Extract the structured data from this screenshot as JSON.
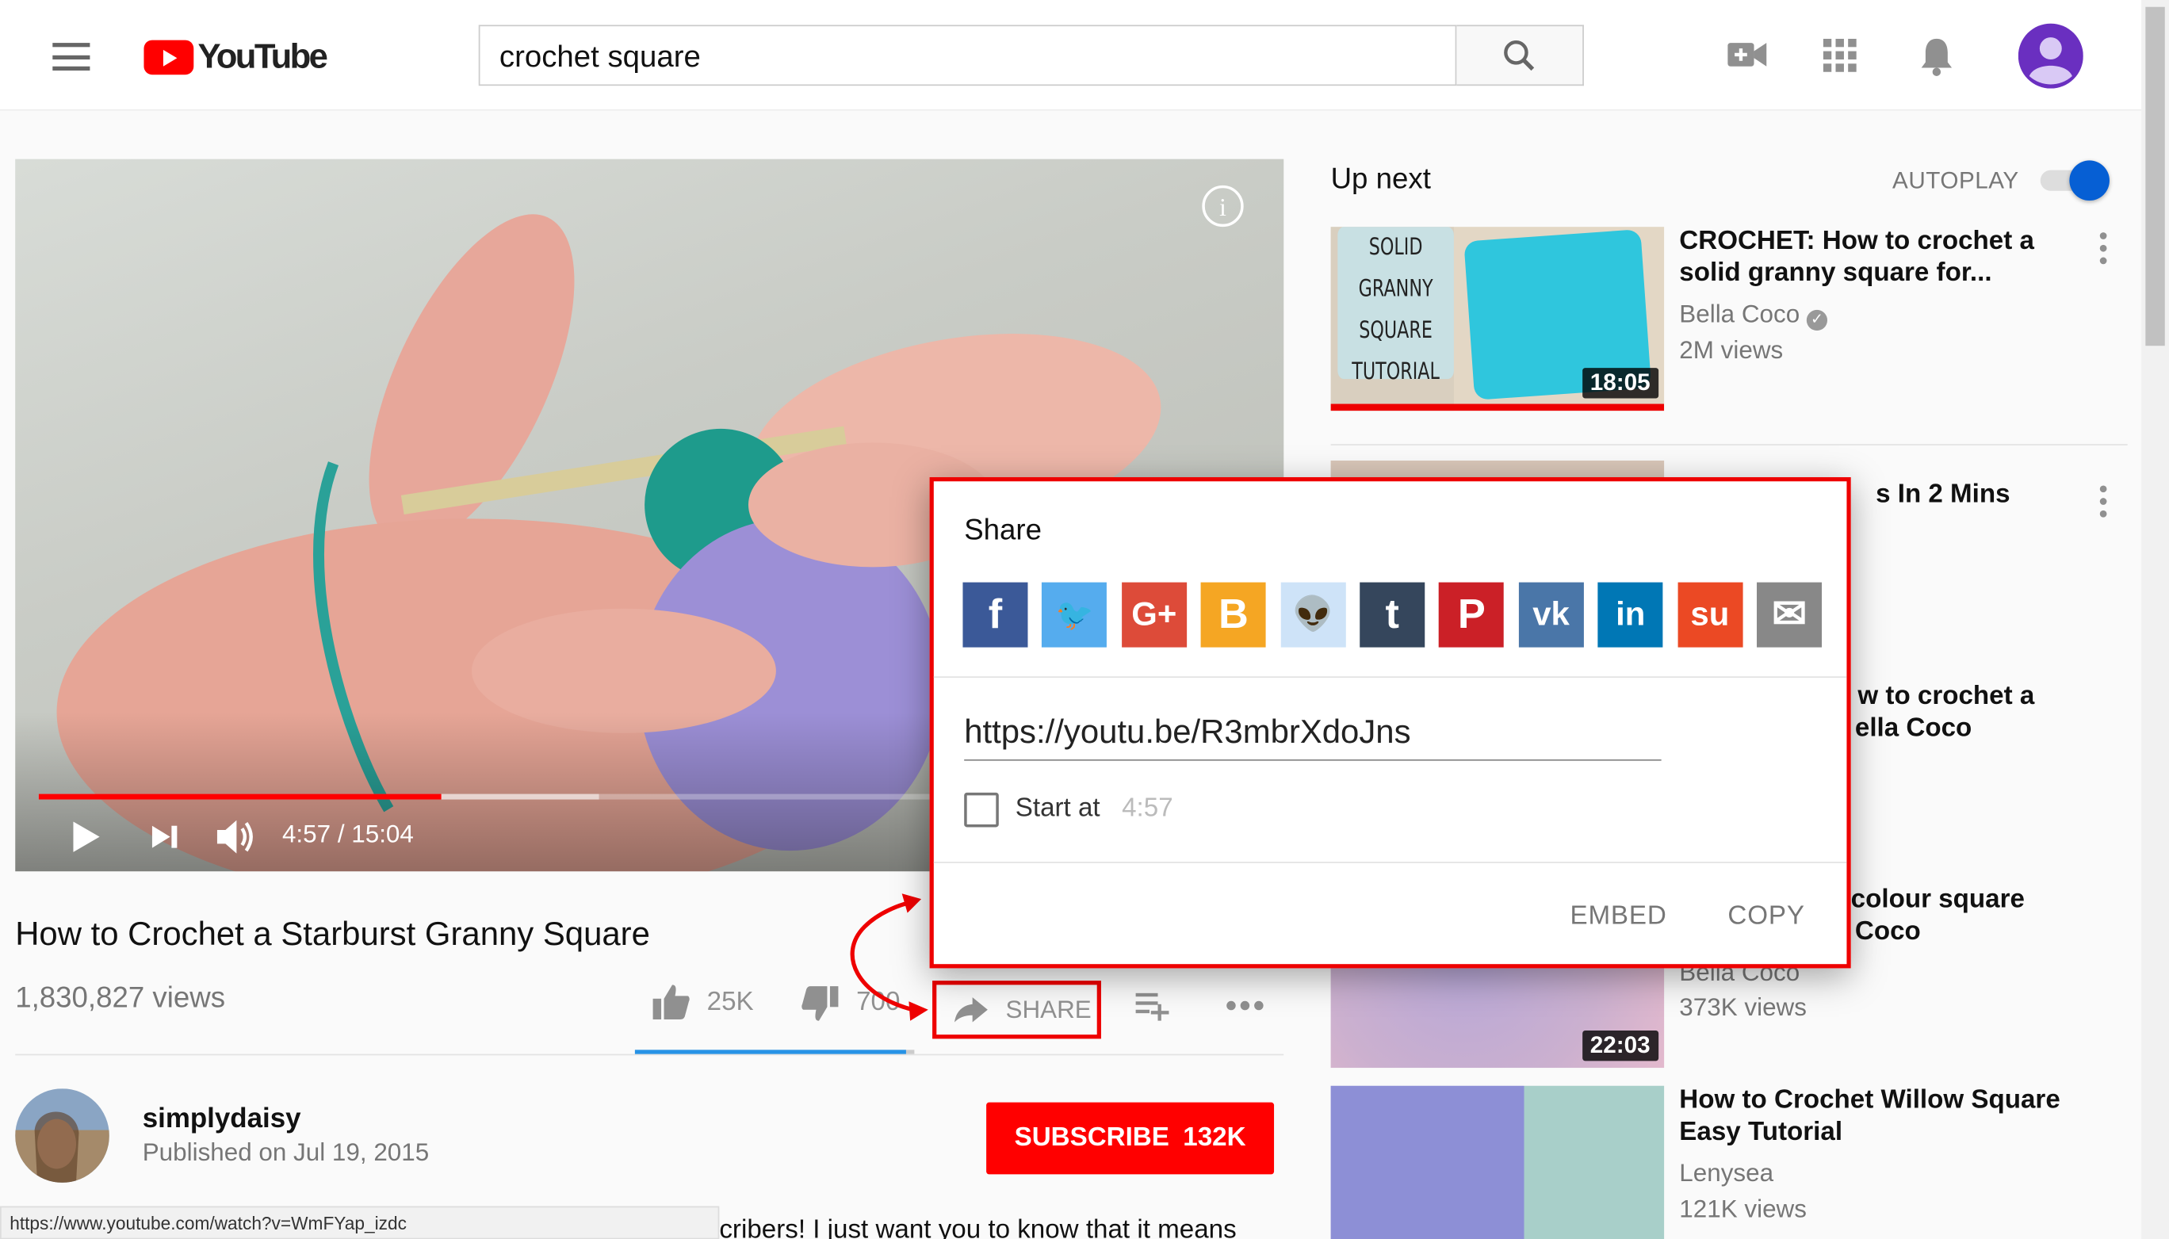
{
  "header": {
    "logo_text": "YouTube",
    "search_value": "crochet square",
    "icons": [
      "menu-icon",
      "search-icon",
      "video-camera-add-icon",
      "apps-grid-icon",
      "bell-icon",
      "account-avatar"
    ]
  },
  "player": {
    "time": "4:57 / 15:04",
    "progress_fraction": 0.329,
    "buffered_fraction": 0.459
  },
  "video": {
    "title": "How to Crochet a Starburst Granny Square",
    "views": "1,830,827 views",
    "likes": "25K",
    "dislikes": "700",
    "share_label": "SHARE",
    "like_ratio": 0.97
  },
  "channel": {
    "name": "simplydaisy",
    "published": "Published on Jul 19, 2015",
    "subscribe_label": "SUBSCRIBE",
    "subscriber_count": "132K"
  },
  "description_fragment": "cribers! I just want you to know that it means",
  "status_bar_url": "https://www.youtube.com/watch?v=WmFYap_izdc",
  "sidebar": {
    "up_next": "Up next",
    "autoplay_label": "AUTOPLAY",
    "autoplay_on": true,
    "items": [
      {
        "title": "CROCHET: How to crochet a solid granny square for...",
        "channel": "Bella Coco",
        "verified": true,
        "views": "2M views",
        "duration": "18:05",
        "thumb_text": [
          "SOLID",
          "GRANNY",
          "SQUARE",
          "TUTORIAL"
        ]
      },
      {
        "title_fragment": "s In 2 Mins"
      },
      {
        "title_fragment_1": "w to crochet a",
        "title_fragment_2": "ella Coco"
      },
      {
        "title_fragment_1": "colour square",
        "title_fragment_2": "Coco",
        "channel": "Bella Coco",
        "views": "373K views",
        "duration": "22:03"
      },
      {
        "title": "How to Crochet Willow Square Easy Tutorial",
        "channel": "Lenysea",
        "views": "121K views"
      }
    ]
  },
  "share_dialog": {
    "title": "Share",
    "networks": [
      {
        "name": "facebook",
        "glyph": "f",
        "color": "#3b5998"
      },
      {
        "name": "twitter",
        "glyph": "🐦",
        "color": "#55acee"
      },
      {
        "name": "google-plus",
        "glyph": "G+",
        "color": "#dd4b39"
      },
      {
        "name": "blogger",
        "glyph": "B",
        "color": "#f5a623"
      },
      {
        "name": "reddit",
        "glyph": "👽",
        "color": "#cee3f8"
      },
      {
        "name": "tumblr",
        "glyph": "t",
        "color": "#35465c"
      },
      {
        "name": "pinterest",
        "glyph": "P",
        "color": "#cb2027"
      },
      {
        "name": "vk",
        "glyph": "vk",
        "color": "#4a76a8"
      },
      {
        "name": "linkedin",
        "glyph": "in",
        "color": "#0077b5"
      },
      {
        "name": "stumbleupon",
        "glyph": "su",
        "color": "#eb4924"
      },
      {
        "name": "email",
        "glyph": "✉",
        "color": "#888888"
      }
    ],
    "url": "https://youtu.be/R3mbrXdoJns",
    "start_at_label": "Start at",
    "start_at_time": "4:57",
    "start_at_checked": false,
    "embed_label": "EMBED",
    "copy_label": "COPY"
  },
  "colors": {
    "brand_red": "#ff0000",
    "annotation_red": "#e00000",
    "accent_blue": "#065fd4"
  }
}
